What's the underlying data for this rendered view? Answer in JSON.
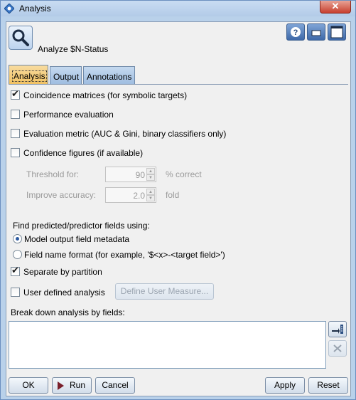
{
  "window": {
    "title": "Analysis",
    "close_glyph": "✕"
  },
  "header": {
    "node_label": "Analyze  $N-Status",
    "node_icon": "magnifier-icon"
  },
  "toolbar": {
    "help_glyph": "?",
    "minimize_glyph": "▁",
    "maximize_glyph": "□"
  },
  "tabs": [
    {
      "label": "Analysis",
      "active": true
    },
    {
      "label": "Output",
      "active": false
    },
    {
      "label": "Annotations",
      "active": false
    }
  ],
  "options": {
    "coincidence": {
      "label": "Coincidence matrices (for symbolic targets)",
      "checked": true
    },
    "performance": {
      "label": "Performance evaluation",
      "checked": false
    },
    "evaluation_metric": {
      "label": "Evaluation metric (AUC & Gini, binary classifiers only)",
      "checked": false
    },
    "confidence": {
      "label": "Confidence figures (if available)",
      "checked": false
    },
    "threshold": {
      "label": "Threshold for:",
      "value": "90",
      "unit": "% correct"
    },
    "improve": {
      "label": "Improve accuracy:",
      "value": "2.0",
      "unit": "fold"
    },
    "find_label": "Find predicted/predictor fields using:",
    "radio_metadata": {
      "label": "Model output field metadata",
      "selected": true
    },
    "radio_format": {
      "label": "Field name format (for example, '$<x>-<target field>')",
      "selected": false
    },
    "separate": {
      "label": "Separate by partition",
      "checked": true
    },
    "user_defined": {
      "label": "User defined analysis",
      "checked": false
    },
    "define_button": "Define User Measure...",
    "breakdown_label": "Break down analysis by fields:"
  },
  "buttons": {
    "ok": "OK",
    "run": "Run",
    "cancel": "Cancel",
    "apply": "Apply",
    "reset": "Reset"
  }
}
